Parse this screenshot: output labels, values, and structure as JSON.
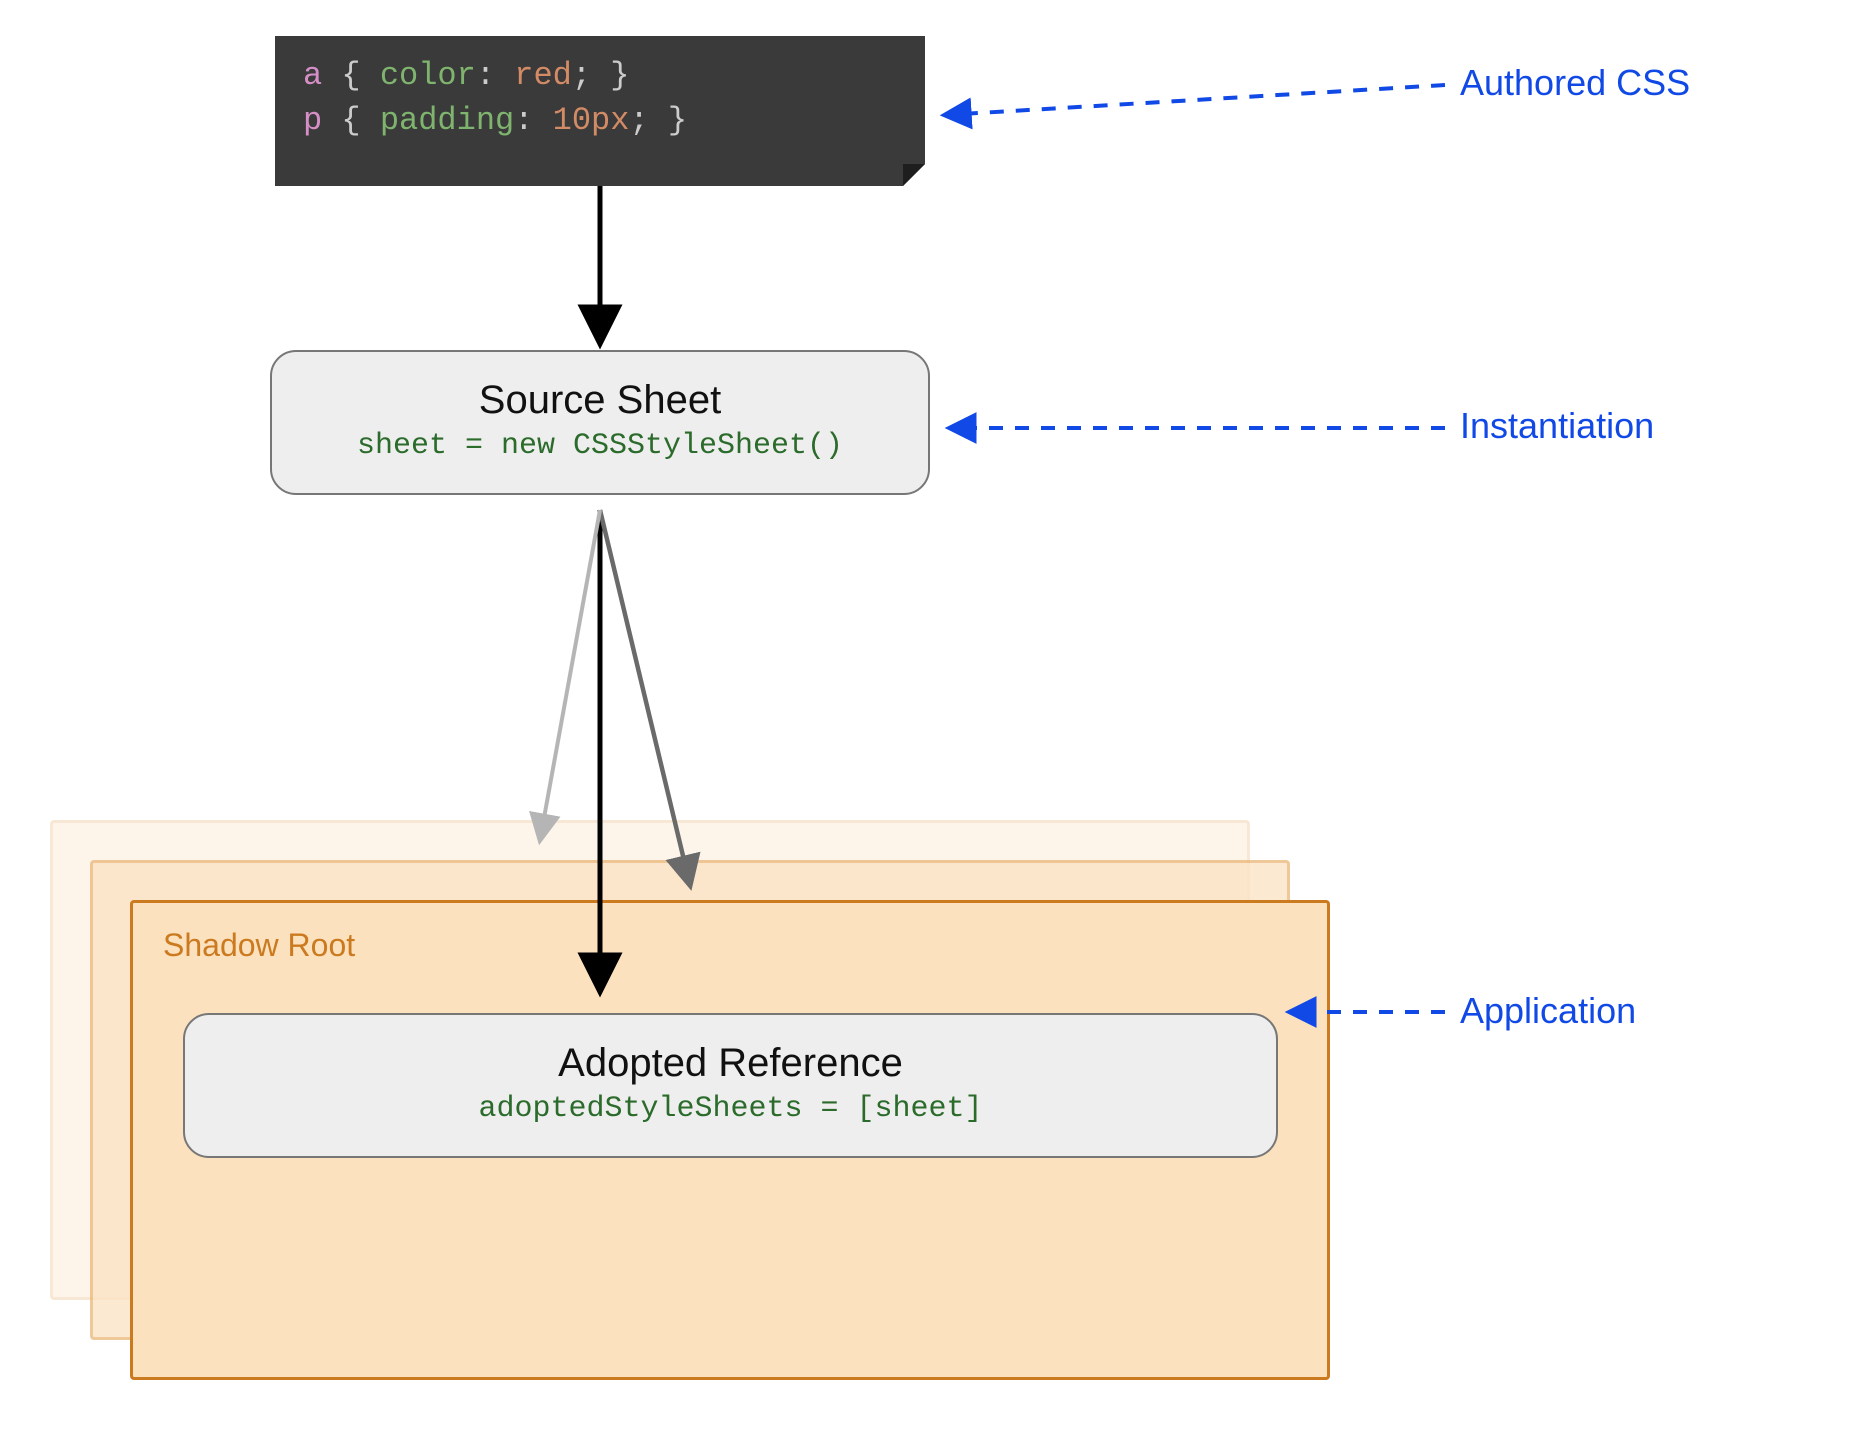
{
  "code": {
    "line1_selector": "a",
    "line1_open": " { ",
    "line1_prop": "color",
    "line1_sep": ": ",
    "line1_val": "red",
    "line1_end": "; }",
    "line2_selector": "p",
    "line2_open": " { ",
    "line2_prop": "padding",
    "line2_sep": ": ",
    "line2_val": "10px",
    "line2_end": "; }"
  },
  "source_sheet": {
    "title": "Source Sheet",
    "code": "sheet = new CSSStyleSheet()"
  },
  "shadow_root": {
    "label": "Shadow Root"
  },
  "adopted": {
    "title": "Adopted Reference",
    "code": "adoptedStyleSheets = [sheet]"
  },
  "annotations": {
    "authored": "Authored CSS",
    "instantiation": "Instantiation",
    "application": "Application"
  }
}
